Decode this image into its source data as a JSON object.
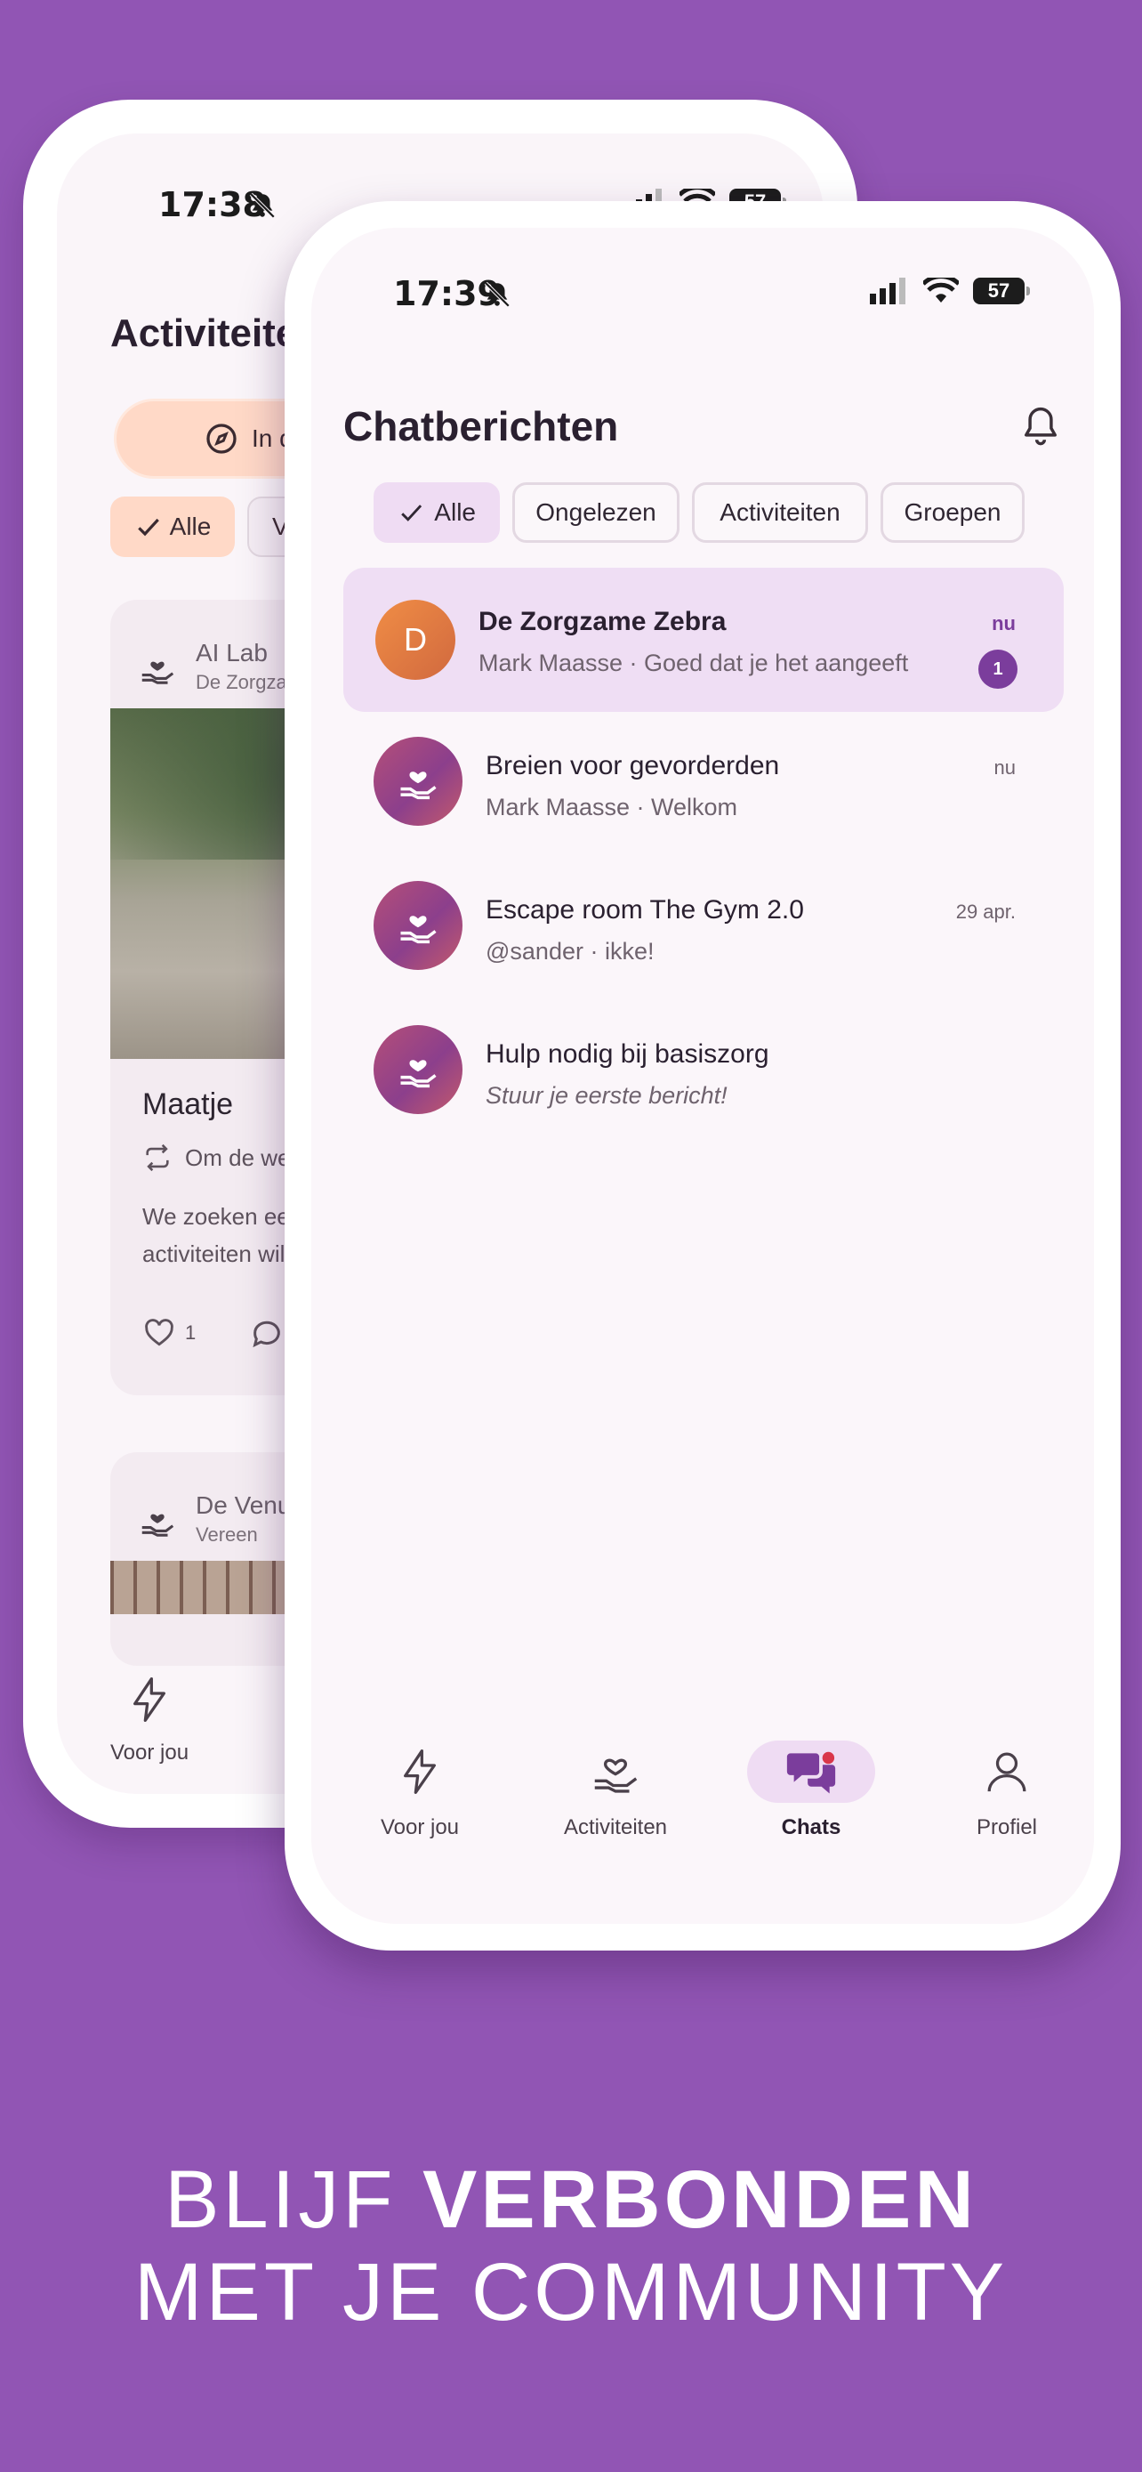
{
  "colors": {
    "background": "#9155b4",
    "accent_purple": "#7b3d9c",
    "chip_active": "#efdcf3",
    "peach": "#ffd9c7"
  },
  "back_phone": {
    "status": {
      "time": "17:38",
      "battery": "57"
    },
    "title": "Activiteiten",
    "filter_big": "In de",
    "chips": [
      {
        "label": "Alle",
        "icon": "check-icon"
      },
      {
        "label": "Van"
      }
    ],
    "card1": {
      "org": "AI Lab",
      "org_sub": "De Zorgzam",
      "title": "Maatje",
      "frequency": "Om de weel",
      "description_line1": "We zoeken een",
      "description_line2": "activiteiten wil",
      "likes": "1"
    },
    "card2": {
      "org": "De Venus",
      "org_sub": "Vereen"
    },
    "nav": {
      "tab1": "Voor jou"
    }
  },
  "front_phone": {
    "status": {
      "time": "17:39",
      "battery": "57"
    },
    "title": "Chatberichten",
    "chips": [
      {
        "label": "Alle",
        "active": true
      },
      {
        "label": "Ongelezen"
      },
      {
        "label": "Activiteiten"
      },
      {
        "label": "Groepen"
      }
    ],
    "chats": [
      {
        "initial": "D",
        "name": "De Zorgzame Zebra",
        "preview": "Mark Maasse · Goed dat je het aangeeft",
        "time": "nu",
        "unread": "1"
      },
      {
        "name": "Breien voor gevorderden",
        "preview": "Mark Maasse · Welkom",
        "time": "nu"
      },
      {
        "name": "Escape room The Gym 2.0",
        "preview": "@sander · ikke!",
        "time": "29 apr."
      },
      {
        "name": "Hulp nodig bij basiszorg",
        "preview": "Stuur je eerste bericht!"
      }
    ],
    "nav": [
      {
        "label": "Voor jou",
        "icon": "lightning-icon"
      },
      {
        "label": "Activiteiten",
        "icon": "heart-hand-icon"
      },
      {
        "label": "Chats",
        "icon": "chat-bubbles-icon",
        "active": true
      },
      {
        "label": "Profiel",
        "icon": "person-icon"
      }
    ]
  },
  "slogan": {
    "line1_regular": "BLIJF ",
    "line1_bold": "VERBONDEN",
    "line2": "MET JE COMMUNITY"
  }
}
